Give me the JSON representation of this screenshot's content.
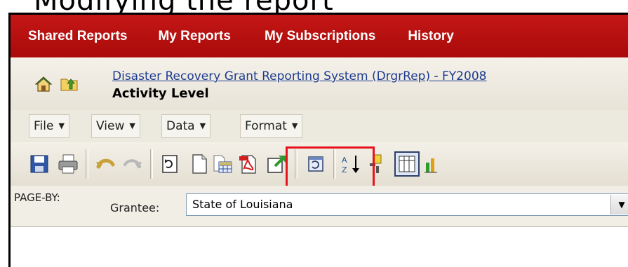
{
  "document": {
    "heading": "Modifying the report"
  },
  "nav": {
    "items": [
      {
        "label": "Shared Reports"
      },
      {
        "label": "My Reports"
      },
      {
        "label": "My Subscriptions"
      },
      {
        "label": "History"
      }
    ]
  },
  "breadcrumb": {
    "link": "Disaster Recovery Grant Reporting System (DrgrRep) - FY2008",
    "report_title": "Activity Level",
    "icons": [
      "home-icon",
      "folder-up-icon"
    ]
  },
  "menu": {
    "items": [
      {
        "label": "File"
      },
      {
        "label": "View"
      },
      {
        "label": "Data"
      },
      {
        "label": "Format"
      }
    ]
  },
  "toolbar": {
    "icons": [
      "save-icon",
      "print-icon",
      "undo-icon",
      "redo-icon",
      "refresh-icon",
      "page-icon",
      "export-excel-icon",
      "export-pdf-icon",
      "export-icon",
      "page-view-icon",
      "sort-icon",
      "pivot-icon",
      "grid-view-icon",
      "graph-view-icon"
    ],
    "highlight_color": "#e8141c"
  },
  "page_by": {
    "label": "PAGE-BY:",
    "field_label": "Grantee:",
    "selected_value": "State of Louisiana"
  },
  "colors": {
    "nav_background": "#b50f0f",
    "link": "#1d3b8f"
  }
}
